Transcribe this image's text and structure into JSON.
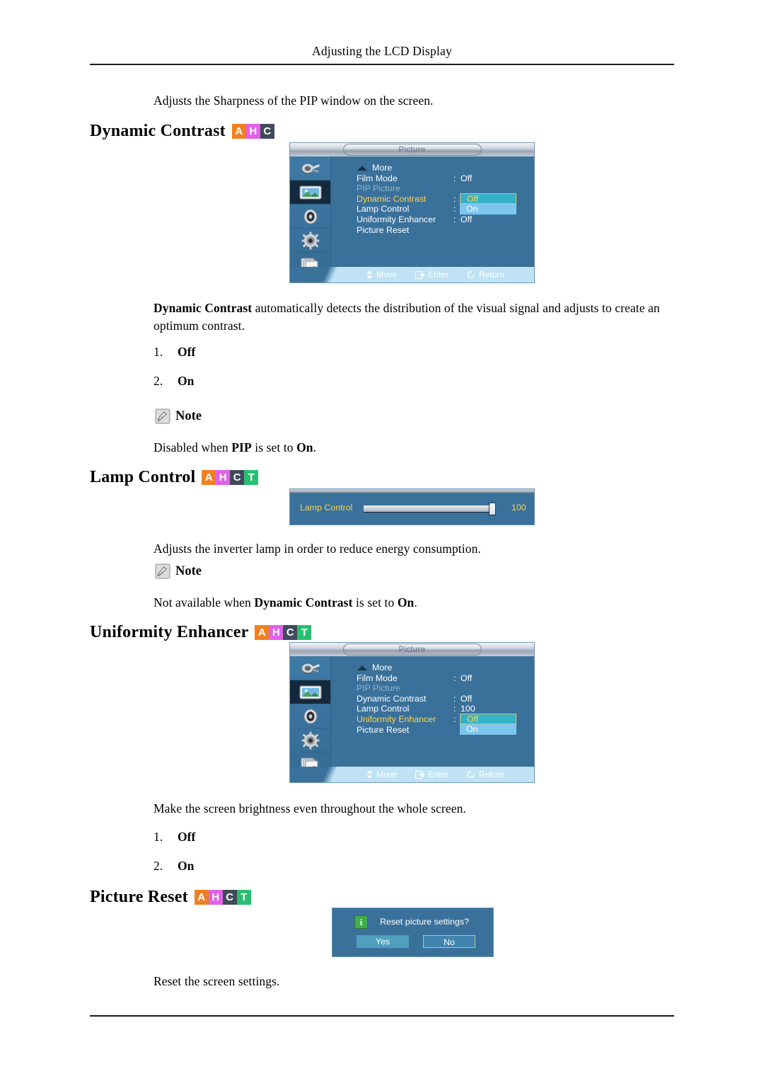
{
  "page": {
    "running_head": "Adjusting the LCD Display"
  },
  "intro": {
    "text": "Adjusts the Sharpness of the PIP window on the screen."
  },
  "badge_letters": {
    "a": "A",
    "h": "H",
    "c": "C",
    "t": "T"
  },
  "sections": {
    "dynamic_contrast": {
      "heading": "Dynamic Contrast",
      "description_bold": "Dynamic Contrast",
      "description_rest": " automatically detects the distribution of the visual signal and adjusts to create an optimum contrast.",
      "options": [
        {
          "num": "1.",
          "value": "Off"
        },
        {
          "num": "2.",
          "value": "On"
        }
      ],
      "note_label": "Note",
      "note_pre": "Disabled when ",
      "note_b1": "PIP",
      "note_mid": " is set to ",
      "note_b2": "On",
      "note_post": "."
    },
    "lamp_control": {
      "heading": "Lamp Control",
      "description": "Adjusts the inverter lamp in order to reduce energy consumption.",
      "note_label": "Note",
      "note_pre": "Not available when ",
      "note_b1": "Dynamic Contrast",
      "note_mid": " is set to ",
      "note_b2": "On",
      "note_post": "."
    },
    "uniformity_enhancer": {
      "heading": "Uniformity Enhancer",
      "description": "Make the screen brightness even throughout the whole screen.",
      "options": [
        {
          "num": "1.",
          "value": "Off"
        },
        {
          "num": "2.",
          "value": "On"
        }
      ]
    },
    "picture_reset": {
      "heading": "Picture Reset",
      "description": "Reset the screen settings."
    }
  },
  "osd_dynamic_contrast": {
    "title": "Picture",
    "rail_icons": [
      "input-source-icon",
      "picture-icon",
      "sound-icon",
      "setup-gear-icon",
      "multi-control-icon"
    ],
    "rows": [
      {
        "label": "More",
        "colon": "",
        "value": "",
        "state": "more"
      },
      {
        "label": "Film Mode",
        "colon": ":",
        "value": "Off",
        "state": "normal"
      },
      {
        "label": "PIP Picture",
        "colon": "",
        "value": "",
        "state": "dim"
      },
      {
        "label": "Dynamic Contrast",
        "colon": ":",
        "value": "",
        "state": "selected"
      },
      {
        "label": "Lamp Control",
        "colon": ":",
        "value": "",
        "state": "normal"
      },
      {
        "label": "Uniformity Enhancer",
        "colon": ":",
        "value": "Off",
        "state": "normal"
      },
      {
        "label": "Picture Reset",
        "colon": "",
        "value": "",
        "state": "normal"
      }
    ],
    "dropdown": {
      "selected": "Off",
      "other": "On"
    },
    "footer": [
      {
        "icon": "move-updown-icon",
        "label": "Move"
      },
      {
        "icon": "enter-icon",
        "label": "Enter"
      },
      {
        "icon": "return-icon",
        "label": "Return"
      }
    ]
  },
  "osd_uniformity_enhancer": {
    "title": "Picture",
    "rail_icons": [
      "input-source-icon",
      "picture-icon",
      "sound-icon",
      "setup-gear-icon",
      "multi-control-icon"
    ],
    "rows": [
      {
        "label": "More",
        "colon": "",
        "value": "",
        "state": "more"
      },
      {
        "label": "Film Mode",
        "colon": ":",
        "value": "Off",
        "state": "normal"
      },
      {
        "label": "PIP Picture",
        "colon": "",
        "value": "",
        "state": "dim"
      },
      {
        "label": "Dynamic Contrast",
        "colon": ":",
        "value": "Off",
        "state": "normal"
      },
      {
        "label": "Lamp Control",
        "colon": ":",
        "value": "100",
        "state": "normal"
      },
      {
        "label": "Uniformity Enhancer",
        "colon": ":",
        "value": "",
        "state": "selected"
      },
      {
        "label": "Picture Reset",
        "colon": "",
        "value": "",
        "state": "normal"
      }
    ],
    "dropdown": {
      "selected": "Off",
      "other": "On"
    },
    "footer": [
      {
        "icon": "move-updown-icon",
        "label": "Move"
      },
      {
        "icon": "enter-icon",
        "label": "Enter"
      },
      {
        "icon": "return-icon",
        "label": "Return"
      }
    ]
  },
  "lamp_control_widget": {
    "label": "Lamp Control",
    "value": "100",
    "slider_percent": 100
  },
  "reset_dialog": {
    "icon": "info-icon",
    "icon_glyph": "i",
    "message": "Reset picture settings?",
    "yes_label": "Yes",
    "no_label": "No",
    "focused_button": "No"
  },
  "colors": {
    "badge_a": "#f08020",
    "badge_h": "#e060e8",
    "badge_c": "#414a5c",
    "badge_t": "#28c070",
    "osd_background": "#3a719b",
    "osd_selected_text": "#ffd24a",
    "osd_dropdown_selected": "#36b1c6",
    "osd_dropdown_other": "#7cc6ee",
    "osd_footer": "#bfe3f4",
    "dialog_info_icon": "#3fae4a"
  }
}
